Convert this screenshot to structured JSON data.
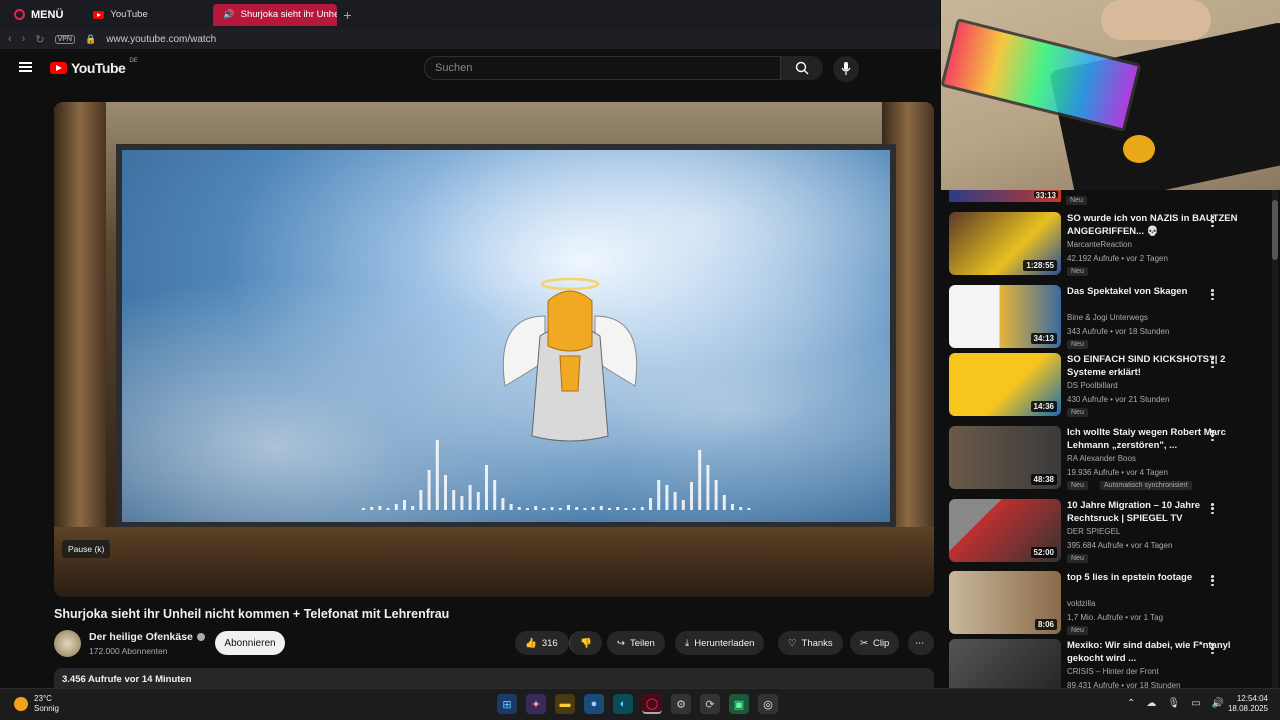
{
  "browser": {
    "menu_label": "MENÜ",
    "tabs": [
      {
        "label": "YouTube"
      },
      {
        "label": "Shurjoka sieht ihr Unheil"
      }
    ],
    "vpn_label": "VPN",
    "url": "www.youtube.com/watch"
  },
  "youtube": {
    "logo_text": "YouTube",
    "country_code": "DE",
    "search_placeholder": "Suchen"
  },
  "player": {
    "tooltip": "Pause (k)"
  },
  "video": {
    "title": "Shurjoka sieht ihr Unheil nicht kommen + Telefonat mit Lehrenfrau",
    "channel": "Der heilige Ofenkäse",
    "subscribers": "172.000 Abonnenten",
    "subscribe_label": "Abonnieren",
    "likes": "316",
    "share_label": "Teilen",
    "download_label": "Herunterladen",
    "thanks_label": "Thanks",
    "clip_label": "Clip",
    "views_line": "3.456 Aufrufe  vor 14 Minuten"
  },
  "sidebar": {
    "top_partial": {
      "duration": "33:13",
      "badge": "Neu"
    },
    "items": [
      {
        "title": "SO wurde ich von NAZIS in BAUTZEN ANGEGRIFFEN... 💀",
        "channel": "MarcanteReaction",
        "meta": "42.192 Aufrufe • vor 2 Tagen",
        "duration": "1:28:55",
        "badge": "Neu"
      },
      {
        "title": "Das Spektakel von Skagen",
        "channel": "Bine & Jogi Unterwegs",
        "meta": "343 Aufrufe • vor 18 Stunden",
        "duration": "34:13",
        "badge": "Neu"
      },
      {
        "title": "SO EINFACH SIND KICKSHOTS?| 2 Systeme erklärt!",
        "channel": "DS Poolbillard",
        "meta": "430 Aufrufe • vor 21 Stunden",
        "duration": "14:36",
        "badge": "Neu"
      },
      {
        "title": "Ich wollte Staiy wegen Robert Marc Lehmann „zerstören\", ...",
        "channel": "RA Alexander Boos",
        "meta": "19.936 Aufrufe • vor 4 Tagen",
        "duration": "48:38",
        "badge": "Neu",
        "badge2": "Automatisch synchronisiert"
      },
      {
        "title": "10 Jahre Migration – 10 Jahre Rechtsruck | SPIEGEL TV",
        "channel": "DER SPIEGEL",
        "meta": "395.684 Aufrufe • vor 4 Tagen",
        "duration": "52:00",
        "badge": "Neu"
      },
      {
        "title": "top 5 lies in epstein footage",
        "channel": "voldzilla",
        "meta": "1,7 Mio. Aufrufe • vor 1 Tag",
        "duration": "8:06",
        "badge": "Neu"
      },
      {
        "title": "Mexiko: Wir sind dabei, wie F*ntanyl gekocht wird ...",
        "channel": "CRISIS – Hinter der Front",
        "meta": "89.431 Aufrufe • vor 18 Stunden",
        "duration": "",
        "badge": ""
      }
    ]
  },
  "taskbar": {
    "temperature": "23°C",
    "weather": "Sonnig",
    "time": "12:54:04",
    "date": "18.08.2025"
  }
}
